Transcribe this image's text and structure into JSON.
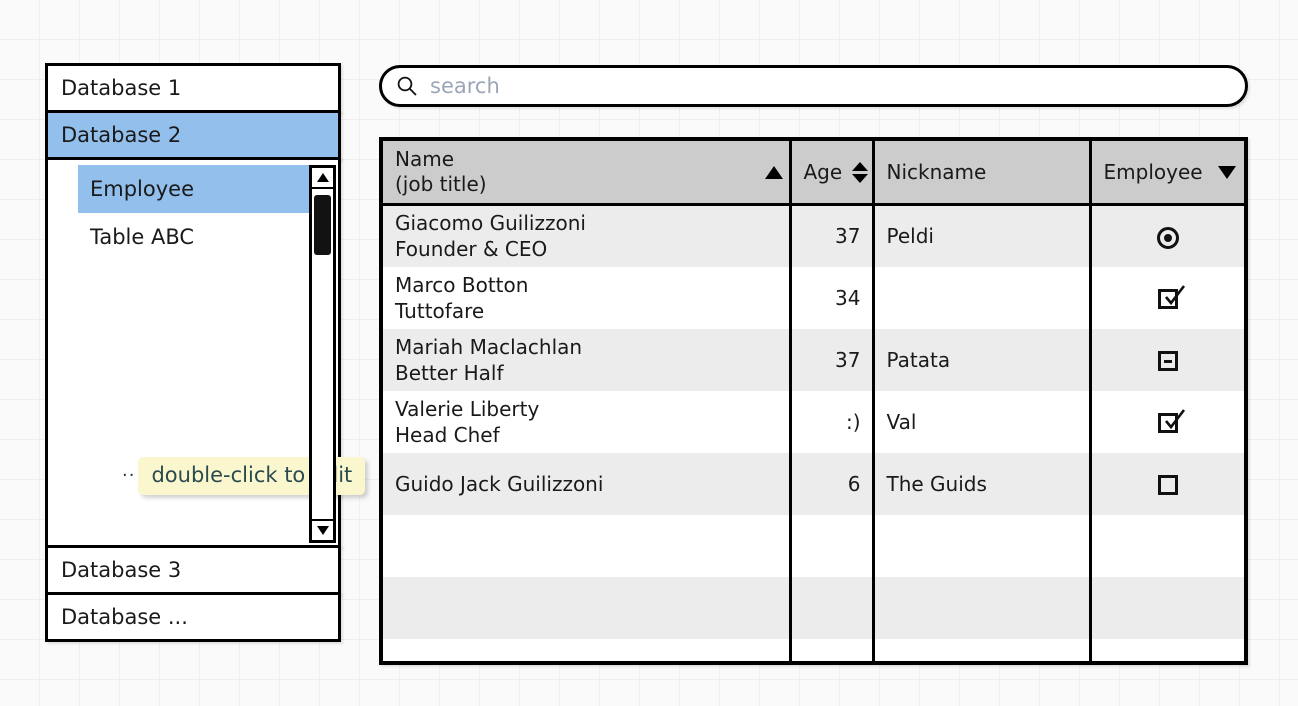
{
  "sidebar": {
    "databases": [
      {
        "label": "Database 1",
        "selected": false
      },
      {
        "label": "Database 2",
        "selected": true
      }
    ],
    "tree_items": [
      {
        "label": "Employee",
        "selected": true
      },
      {
        "label": "Table ABC",
        "selected": false
      }
    ],
    "databases_bottom": [
      {
        "label": "Database 3",
        "selected": false
      },
      {
        "label": "Database ...",
        "selected": false
      }
    ],
    "scrollbar": {
      "up_icon": "triangle-up-icon",
      "down_icon": "triangle-down-icon"
    }
  },
  "tooltip": {
    "text": "double-click to edit",
    "dots": "··",
    "background": "#faf7cf",
    "color": "#2b4a4e"
  },
  "search": {
    "icon": "search-icon",
    "value": "",
    "placeholder": "search"
  },
  "table": {
    "columns": [
      {
        "label": "Name",
        "sublabel": "(job title)",
        "sort": "asc",
        "sort_icon": "triangle-up-icon"
      },
      {
        "label": "Age",
        "sublabel": "",
        "sort": "both",
        "sort_icon": "sort-updown-icon"
      },
      {
        "label": "Nickname",
        "sublabel": "",
        "sort": "none",
        "sort_icon": ""
      },
      {
        "label": "Employee",
        "sublabel": "",
        "sort": "desc",
        "sort_icon": "triangle-down-icon"
      }
    ],
    "rows": [
      {
        "name": "Giacomo Guilizzoni",
        "job_title": "Founder & CEO",
        "age": "37",
        "nickname": "Peldi",
        "employee": "radio-selected"
      },
      {
        "name": "Marco Botton",
        "job_title": "Tuttofare",
        "age": "34",
        "nickname": "",
        "employee": "checkbox-checked"
      },
      {
        "name": "Mariah Maclachlan",
        "job_title": "Better Half",
        "age": "37",
        "nickname": "Patata",
        "employee": "checkbox-indeterminate"
      },
      {
        "name": "Valerie Liberty",
        "job_title": "Head Chef",
        "age": ":)",
        "nickname": "Val",
        "employee": "checkbox-checked"
      },
      {
        "name": "Guido Jack Guilizzoni",
        "job_title": "",
        "age": "6",
        "nickname": "The Guids",
        "employee": "checkbox-empty"
      },
      {
        "name": "",
        "job_title": "",
        "age": "",
        "nickname": "",
        "employee": ""
      },
      {
        "name": "",
        "job_title": "",
        "age": "",
        "nickname": "",
        "employee": ""
      },
      {
        "name": "",
        "job_title": "",
        "age": "",
        "nickname": "",
        "employee": ""
      }
    ]
  },
  "colors": {
    "selection_blue": "#93bfec",
    "header_gray": "#cccccc",
    "row_alt_gray": "#ececec",
    "outline_black": "#000000",
    "tooltip_yellow": "#faf7cf"
  }
}
